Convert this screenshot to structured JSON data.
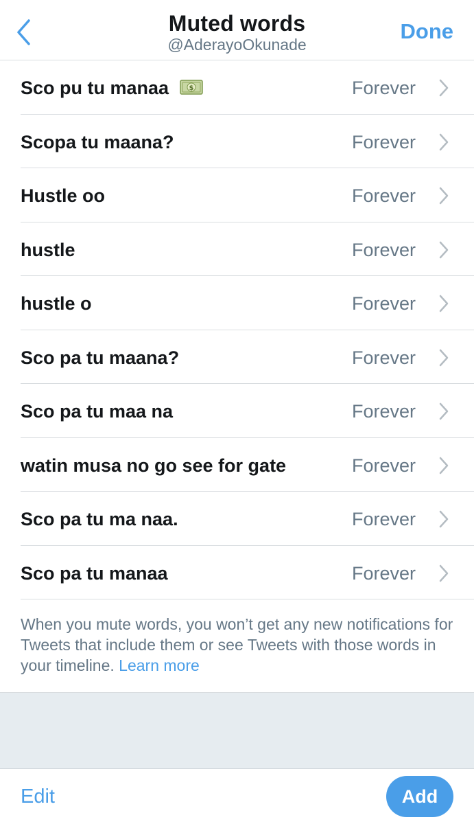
{
  "header": {
    "title": "Muted words",
    "subtitle": "@AderayoOkunade",
    "done_label": "Done",
    "back_icon": "chevron-left-icon"
  },
  "muted_words": [
    {
      "word": "Sco pu tu manaa",
      "emoji": "money-with-dollar-sign-emoji",
      "duration": "Forever"
    },
    {
      "word": "Scopa tu maana?",
      "duration": "Forever"
    },
    {
      "word": "Hustle oo",
      "duration": "Forever"
    },
    {
      "word": "hustle",
      "duration": "Forever"
    },
    {
      "word": "hustle o",
      "duration": "Forever"
    },
    {
      "word": "Sco pa tu maana?",
      "duration": "Forever"
    },
    {
      "word": "Sco pa tu maa na",
      "duration": "Forever"
    },
    {
      "word": "watin musa no go see for gate",
      "duration": "Forever"
    },
    {
      "word": "Sco pa tu ma naa.",
      "duration": "Forever"
    },
    {
      "word": "Sco pa tu manaa",
      "duration": "Forever"
    }
  ],
  "note": {
    "text": "When you mute words, you won’t get any new notifications for Tweets that include them or see Tweets with those words in your timeline.",
    "link_label": "Learn more"
  },
  "toolbar": {
    "edit_label": "Edit",
    "add_label": "Add"
  },
  "colors": {
    "accent": "#4a9ee8",
    "primary_text": "#14171a",
    "secondary_text": "#657786",
    "divider": "#d9dde0",
    "section_background": "#e6ecf0"
  }
}
